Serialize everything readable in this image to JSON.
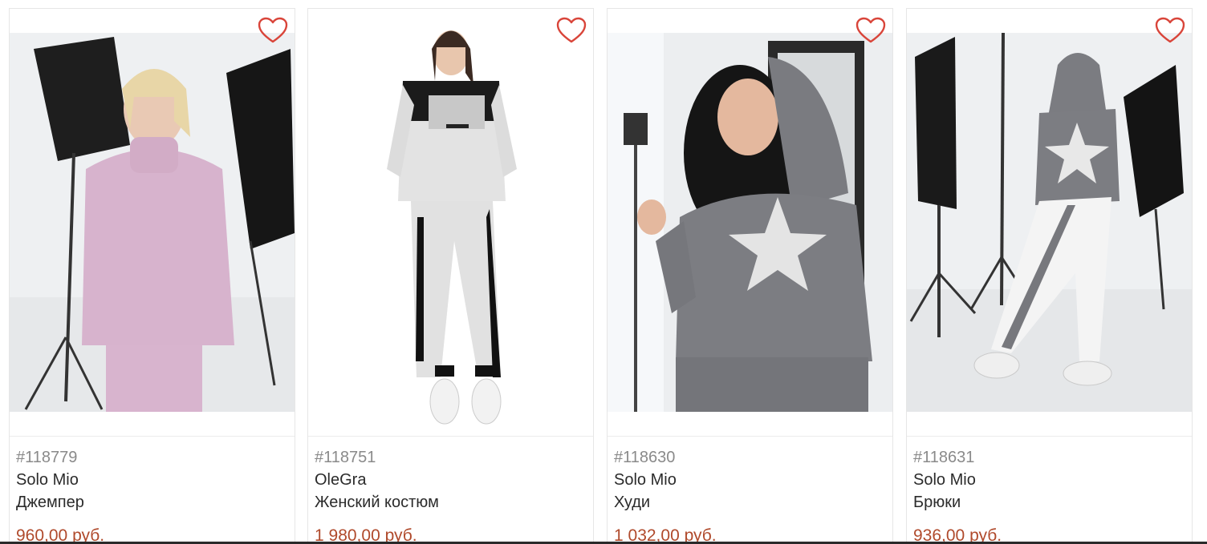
{
  "accent_color": "#b04a2c",
  "favorite_icon": "heart-outline-icon",
  "products": [
    {
      "sku": "#118779",
      "brand": "Solo Mio",
      "name": "Джемпер",
      "price": "960,00 руб."
    },
    {
      "sku": "#118751",
      "brand": "OleGra",
      "name": "Женский костюм",
      "price": "1 980,00 руб."
    },
    {
      "sku": "#118630",
      "brand": "Solo Mio",
      "name": "Худи",
      "price": "1 032,00 руб."
    },
    {
      "sku": "#118631",
      "brand": "Solo Mio",
      "name": "Брюки",
      "price": "936,00 руб."
    }
  ]
}
